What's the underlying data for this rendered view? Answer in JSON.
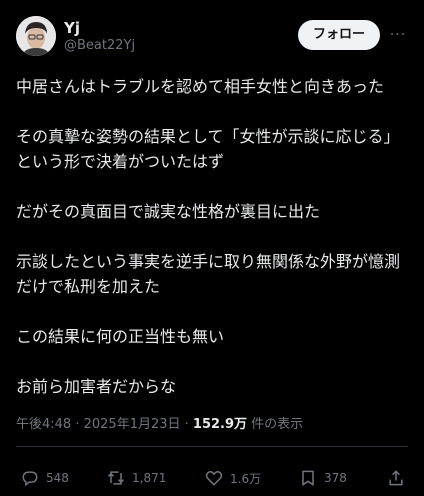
{
  "author": {
    "display_name": "Yj",
    "handle": "@Beat22Yj"
  },
  "follow_label": "フォロー",
  "more_label": "···",
  "paragraphs": [
    "中居さんはトラブルを認めて相手女性と向きあった",
    "その真摯な姿勢の結果として「女性が示談に応じる」という形で決着がついたはず",
    "だがその真面目で誠実な性格が裏目に出た",
    "示談したという事実を逆手に取り無関係な外野が憶測だけで私刑を加えた",
    "この結果に何の正当性も無い",
    "お前ら加害者だからな"
  ],
  "meta": {
    "time": "午後4:48",
    "separator": " · ",
    "date": "2025年1月23日",
    "views_count": "152.9万",
    "views_label": " 件の表示"
  },
  "actions": {
    "replies": "548",
    "retweets": "1,871",
    "likes": "1.6万",
    "bookmarks": "378"
  },
  "colors": {
    "background": "#000000",
    "text": "#e7e9ea",
    "secondary": "#71767b",
    "follow_bg": "#eff3f4"
  },
  "icons": [
    "reply-icon",
    "retweet-icon",
    "like-icon",
    "bookmark-icon",
    "share-icon"
  ]
}
